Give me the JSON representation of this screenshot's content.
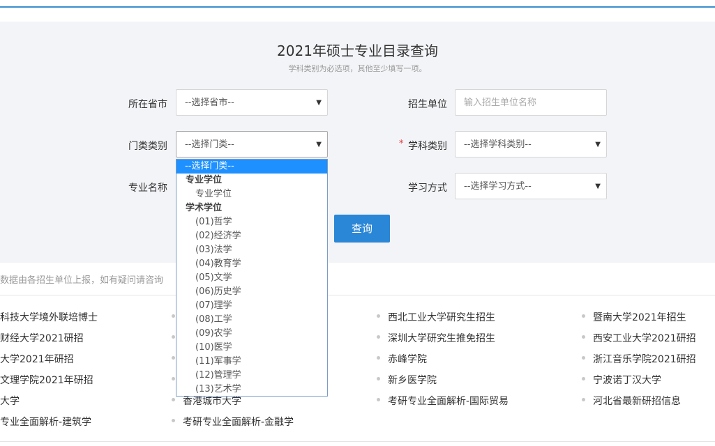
{
  "page": {
    "title": "2021年硕士专业目录查询",
    "subtitle": "学科类别为必选项，其他至少填写一项。"
  },
  "form": {
    "province_label": "所在省市",
    "province_value": "--选择省市--",
    "unit_label": "招生单位",
    "unit_placeholder": "输入招生单位名称",
    "category_label": "门类类别",
    "category_value": "--选择门类--",
    "required_mark": "*",
    "discipline_label": "学科类别",
    "discipline_value": "--选择学科类别--",
    "major_label": "专业名称",
    "study_mode_label": "学习方式",
    "study_mode_value": "--选择学习方式--",
    "query_button": "查询",
    "arrow_icon": "▼"
  },
  "dropdown": {
    "selected": "--选择门类--",
    "groups": [
      {
        "label": "专业学位",
        "options": [
          "专业学位"
        ]
      },
      {
        "label": "学术学位",
        "options": [
          "(01)哲学",
          "(02)经济学",
          "(03)法学",
          "(04)教育学",
          "(05)文学",
          "(06)历史学",
          "(07)理学",
          "(08)工学",
          "(09)农学",
          "(10)医学",
          "(11)军事学",
          "(12)管理学",
          "(13)艺术学"
        ]
      }
    ]
  },
  "notice": "数据由各招生单位上报，如有疑问请咨询",
  "links": {
    "col1": [
      "科技大学境外联培博士",
      "财经大学2021研招",
      "大学2021年研招",
      "文理学院2021年研招",
      "大学",
      "专业全面解析-建筑学"
    ],
    "col2": [
      "香港城市大学",
      "考研专业全面解析-金融学"
    ],
    "col3": [
      "西北工业大学研究生招生",
      "深圳大学研究生推免招生",
      "赤峰学院",
      "新乡医学院",
      "考研专业全面解析-国际贸易"
    ],
    "col4": [
      "暨南大学2021年招生",
      "西安工业大学2021研招",
      "浙江音乐学院2021研招",
      "宁波诺丁汉大学",
      "河北省最新研招信息"
    ]
  }
}
